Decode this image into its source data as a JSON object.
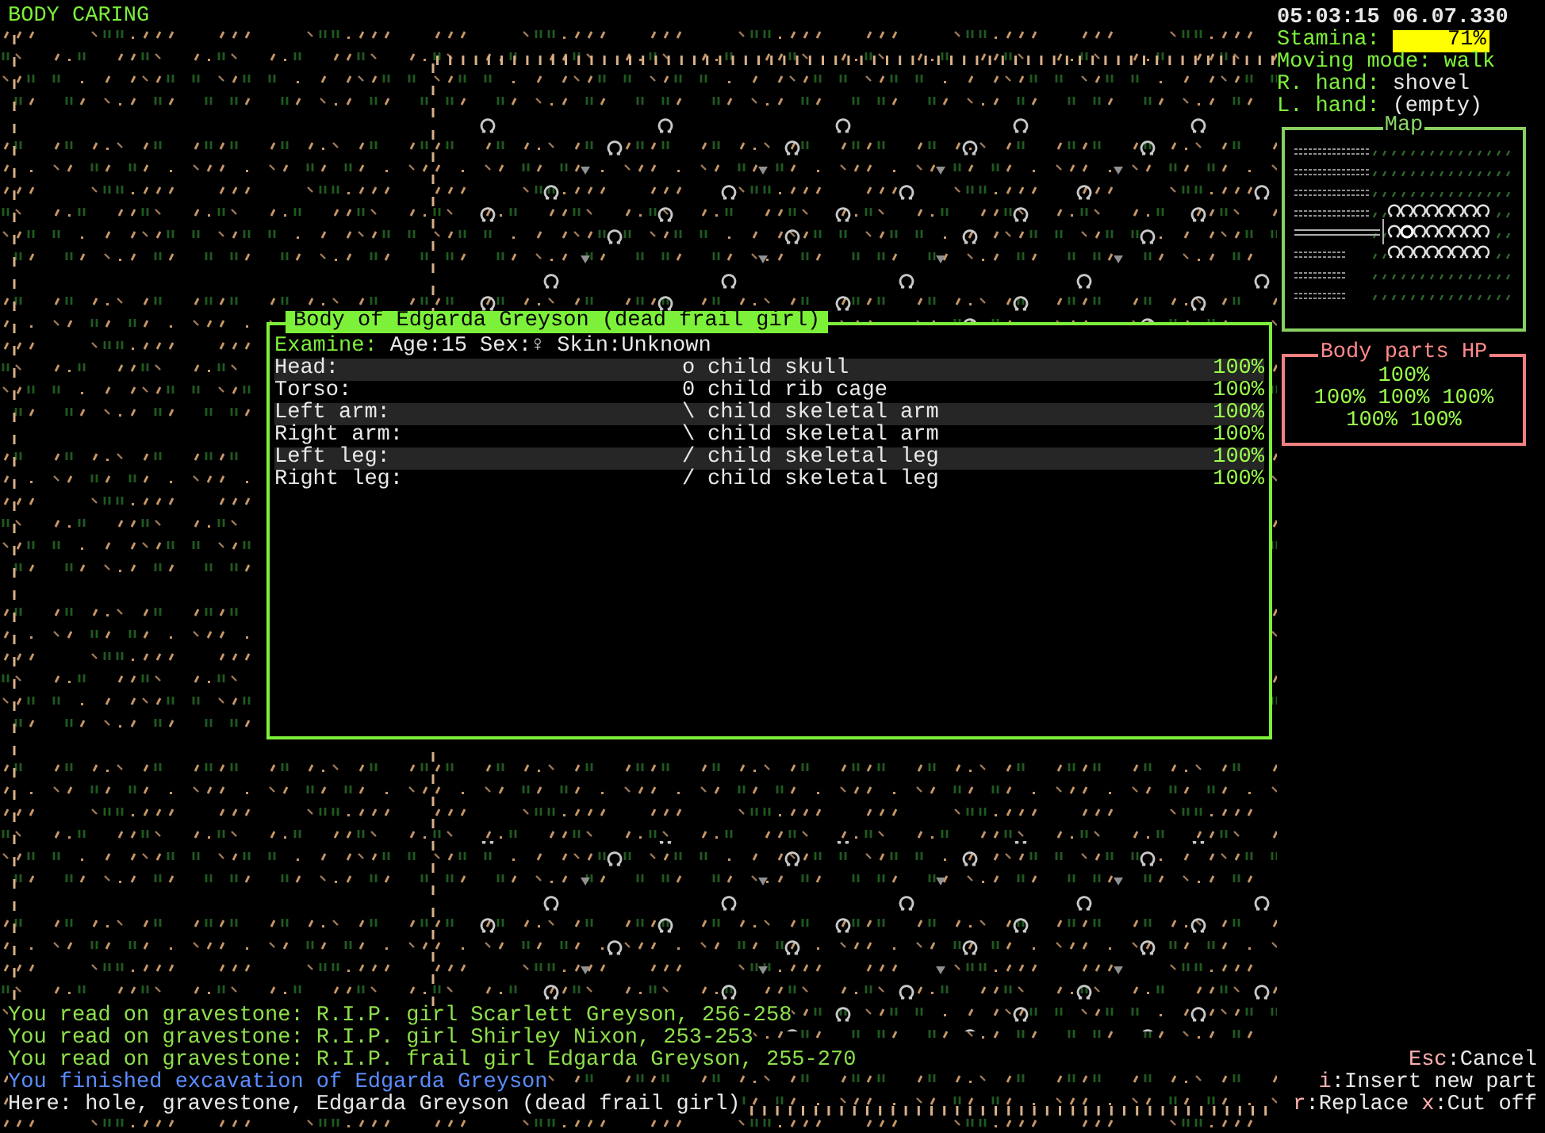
{
  "title": "BODY CARING",
  "status": {
    "time": "05:03:15 06.07.330",
    "stamina_label": "Stamina:",
    "stamina_reading": "71%",
    "moving_mode_label": "Moving mode:",
    "moving_mode": "walk",
    "right_hand_label": "R. hand:",
    "right_hand": "shovel",
    "left_hand_label": "L. hand:",
    "left_hand": "(empty)"
  },
  "minimap": {
    "title": "Map"
  },
  "body_parts_hp": {
    "title": "Body parts HP",
    "rows": [
      [
        "100%"
      ],
      [
        "100%",
        "100%",
        "100%"
      ],
      [
        "100%",
        "100%"
      ]
    ]
  },
  "dialog": {
    "title": "Body of Edgarda Greyson (dead frail girl)",
    "examine_label": "Examine:",
    "examine_text": "Age:15 Sex:♀ Skin:Unknown",
    "parts": [
      {
        "name": "Head:",
        "symbol": "o",
        "item": "child skull",
        "hp": "100%"
      },
      {
        "name": "Torso:",
        "symbol": "0",
        "item": "child rib cage",
        "hp": "100%"
      },
      {
        "name": "Left arm:",
        "symbol": "\\",
        "item": "child skeletal arm",
        "hp": "100%"
      },
      {
        "name": "Right arm:",
        "symbol": "\\",
        "item": "child skeletal arm",
        "hp": "100%"
      },
      {
        "name": "Left leg:",
        "symbol": "/",
        "item": "child skeletal leg",
        "hp": "100%"
      },
      {
        "name": "Right leg:",
        "symbol": "/",
        "item": "child skeletal leg",
        "hp": "100%"
      }
    ]
  },
  "log": [
    {
      "kind": "message",
      "text": "You read on gravestone: R.I.P. girl Scarlett Greyson, 256-258"
    },
    {
      "kind": "message",
      "text": "You read on gravestone: R.I.P. girl Shirley Nixon, 253-253"
    },
    {
      "kind": "message",
      "text": "You read on gravestone: R.I.P. frail girl Edgarda Greyson, 255-270"
    },
    {
      "kind": "event",
      "text": "You finished excavation of Edgarda Greyson"
    },
    {
      "kind": "here",
      "text": "Here: hole, gravestone, Edgarda Greyson (dead frail girl)"
    }
  ],
  "keys": [
    [
      {
        "key": "Esc",
        "action": ":Cancel"
      }
    ],
    [
      {
        "key": "i",
        "action": ":Insert new part"
      }
    ],
    [
      {
        "key": "r",
        "action": ":Replace"
      },
      {
        "key": "x",
        "action": ":Cut off"
      }
    ]
  ]
}
